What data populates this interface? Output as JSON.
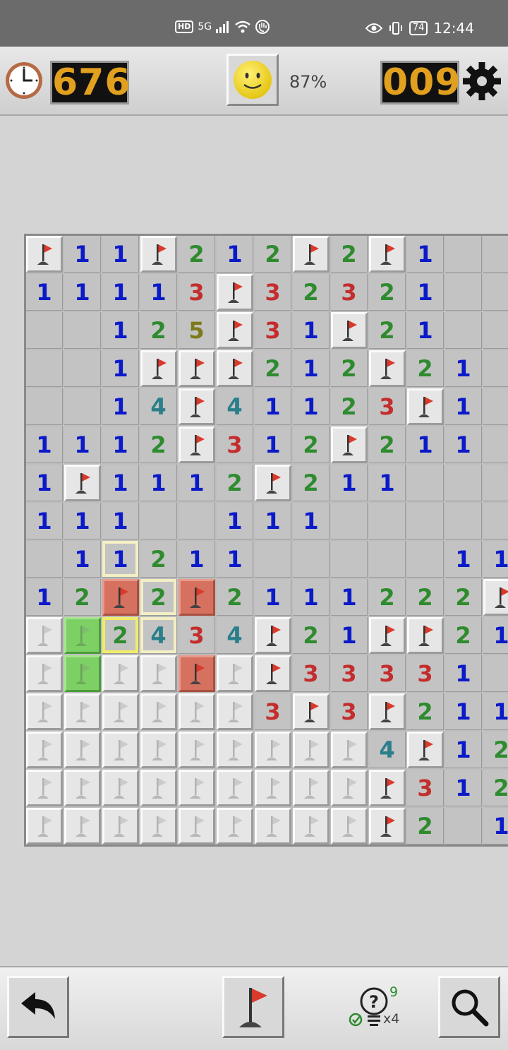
{
  "status_bar": {
    "hd": "HD",
    "network": "5G",
    "battery": "74",
    "time": "12:44"
  },
  "game": {
    "timer": "676",
    "progress": "87%",
    "mines_left": "009"
  },
  "hint": {
    "count": "9",
    "multiplier": "x4"
  },
  "colors": {
    "lcd_digits": "#e2a01f",
    "one": "#0b1ac8",
    "two": "#2e8b2e",
    "three": "#c42d2d",
    "four": "#2a7f8a",
    "five": "#7d7a1a",
    "flag": "#d93a2b",
    "wrong_flag": "#d6705f",
    "green_cell": "#7dd164"
  },
  "board": {
    "legend": "F=flag, C=covered, G=green covered, R=red flagged, .=empty revealed, digits=revealed number; y/c suffix = yellow/cream highlight",
    "rows": [
      [
        "F",
        "1",
        "1",
        "F",
        "2",
        "1",
        "2",
        "F",
        "2",
        "F",
        "1",
        ".",
        "."
      ],
      [
        "1",
        "1",
        "1",
        "1",
        "3",
        "F",
        "3",
        "2",
        "3",
        "2",
        "1",
        ".",
        "."
      ],
      [
        ".",
        ".",
        "1",
        "2",
        "5",
        "F",
        "3",
        "1",
        "F",
        "2",
        "1",
        ".",
        "."
      ],
      [
        ".",
        ".",
        "1",
        "F",
        "F",
        "F",
        "2",
        "1",
        "2",
        "F",
        "2",
        "1",
        "."
      ],
      [
        ".",
        ".",
        "1",
        "4",
        "F",
        "4",
        "1",
        "1",
        "2",
        "3",
        "F",
        "1",
        "."
      ],
      [
        "1",
        "1",
        "1",
        "2",
        "F",
        "3",
        "1",
        "2",
        "F",
        "2",
        "1",
        "1",
        "."
      ],
      [
        "1",
        "F",
        "1",
        "1",
        "1",
        "2",
        "F",
        "2",
        "1",
        "1",
        ".",
        ".",
        "."
      ],
      [
        "1",
        "1",
        "1",
        ".",
        ".",
        "1",
        "1",
        "1",
        ".",
        ".",
        ".",
        ".",
        "."
      ],
      [
        ".",
        "1",
        "1c",
        "2",
        "1",
        "1",
        ".",
        ".",
        ".",
        ".",
        ".",
        "1",
        "1"
      ],
      [
        "1",
        "2",
        "R",
        "2c",
        "R",
        "2",
        "1",
        "1",
        "1",
        "2",
        "2",
        "2",
        "F"
      ],
      [
        "C",
        "G",
        "2y",
        "4c",
        "3",
        "4",
        "F",
        "2",
        "1",
        "F",
        "F",
        "2",
        "1"
      ],
      [
        "C",
        "G",
        "C",
        "C",
        "R",
        "C",
        "F",
        "3",
        "3",
        "3",
        "3",
        "1",
        "."
      ],
      [
        "C",
        "C",
        "C",
        "C",
        "C",
        "C",
        "3",
        "F",
        "3",
        "F",
        "2",
        "1",
        "1"
      ],
      [
        "C",
        "C",
        "C",
        "C",
        "C",
        "C",
        "C",
        "C",
        "C",
        "4",
        "F",
        "1",
        "2"
      ],
      [
        "C",
        "C",
        "C",
        "C",
        "C",
        "C",
        "C",
        "C",
        "C",
        "F",
        "3",
        "1",
        "2"
      ],
      [
        "C",
        "C",
        "C",
        "C",
        "C",
        "C",
        "C",
        "C",
        "C",
        "F",
        "2",
        ".",
        "1"
      ]
    ]
  }
}
